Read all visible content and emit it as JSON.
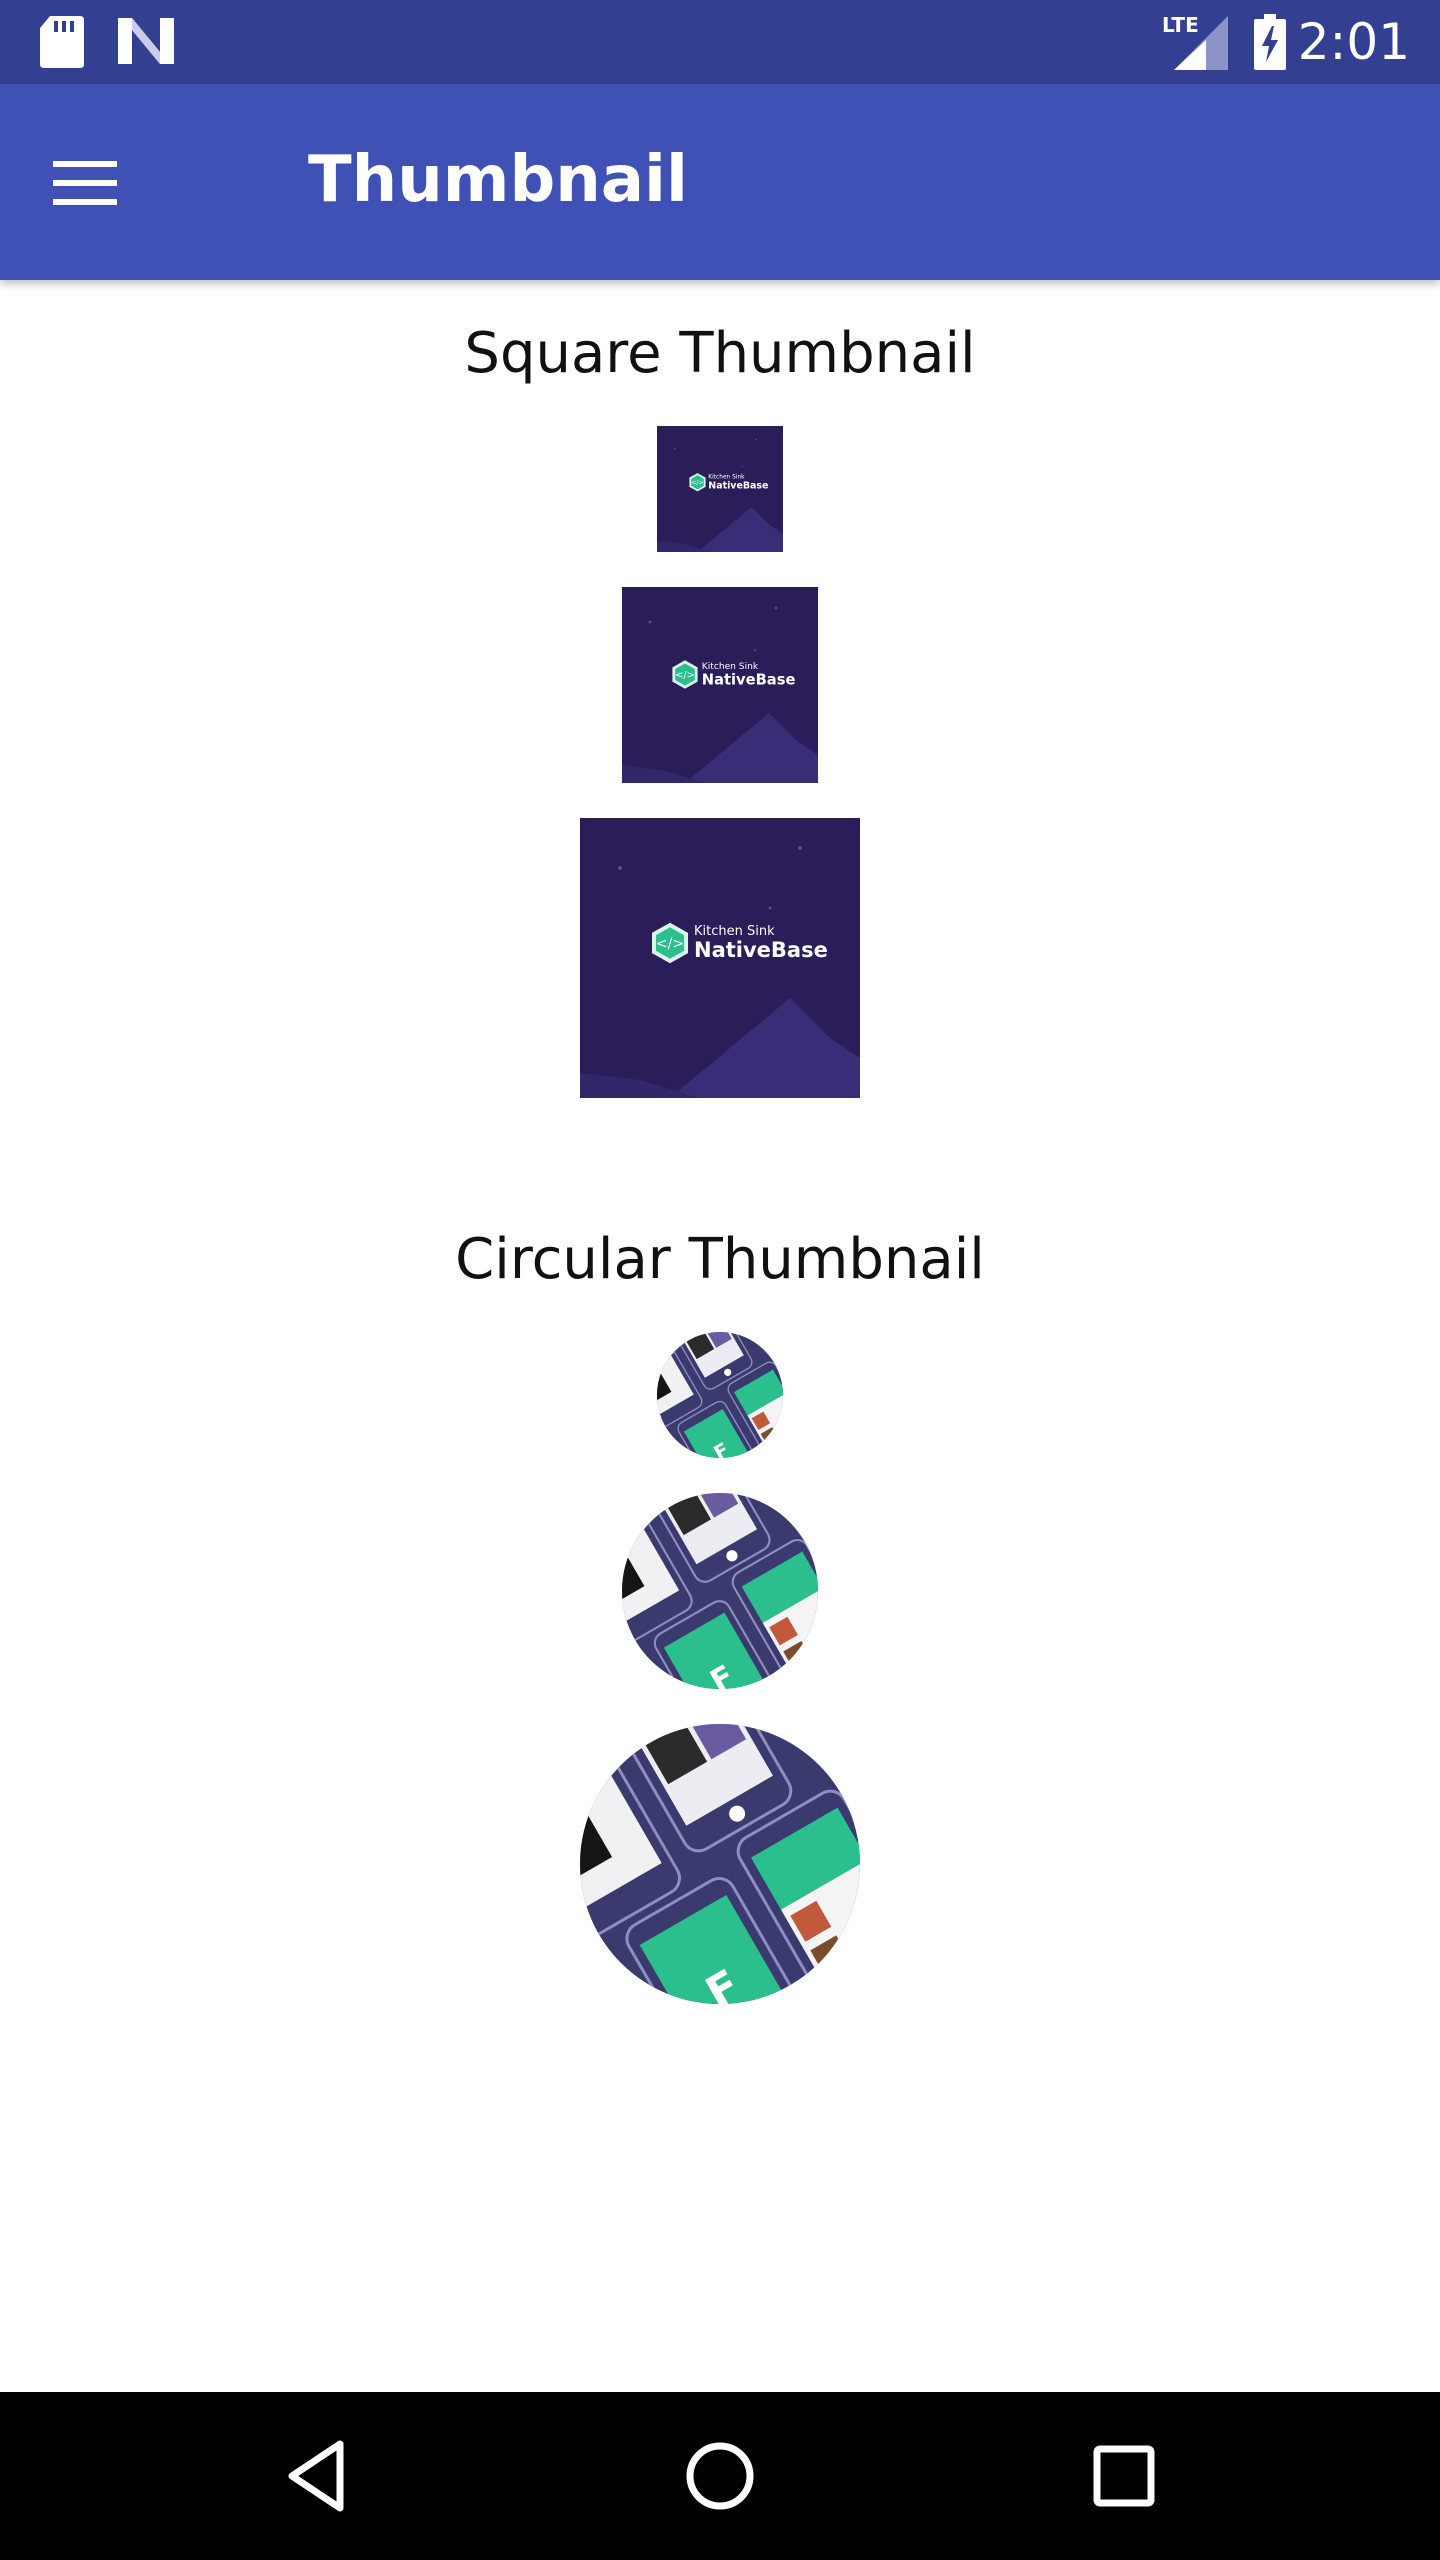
{
  "status_bar": {
    "time": "2:01",
    "network_label": "LTE",
    "icons": [
      "sd-card-icon",
      "n-logo-icon",
      "lte-signal-icon",
      "battery-charging-icon"
    ]
  },
  "app_bar": {
    "title": "Thumbnail",
    "menu_icon": "hamburger-menu-icon"
  },
  "square_section": {
    "title": "Square Thumbnail",
    "thumbnails": [
      {
        "size": "small",
        "logo_kicker": "Kitchen Sink",
        "logo_name": "NativeBase"
      },
      {
        "size": "medium",
        "logo_kicker": "Kitchen Sink",
        "logo_name": "NativeBase"
      },
      {
        "size": "large",
        "logo_kicker": "Kitchen Sink",
        "logo_name": "NativeBase"
      }
    ]
  },
  "circular_section": {
    "title": "Circular Thumbnail",
    "thumbnails": [
      {
        "size": "small",
        "image": "app-screens-collage"
      },
      {
        "size": "medium",
        "image": "app-screens-collage"
      },
      {
        "size": "large",
        "image": "app-screens-collage"
      }
    ]
  },
  "nav_bar": {
    "icons": [
      "back-icon",
      "home-icon",
      "recents-icon"
    ]
  },
  "colors": {
    "status_bar": "#334092",
    "app_bar": "#3f51b5",
    "thumb_bg": "#2a1d5a",
    "accent_green": "#2bbf8e"
  }
}
